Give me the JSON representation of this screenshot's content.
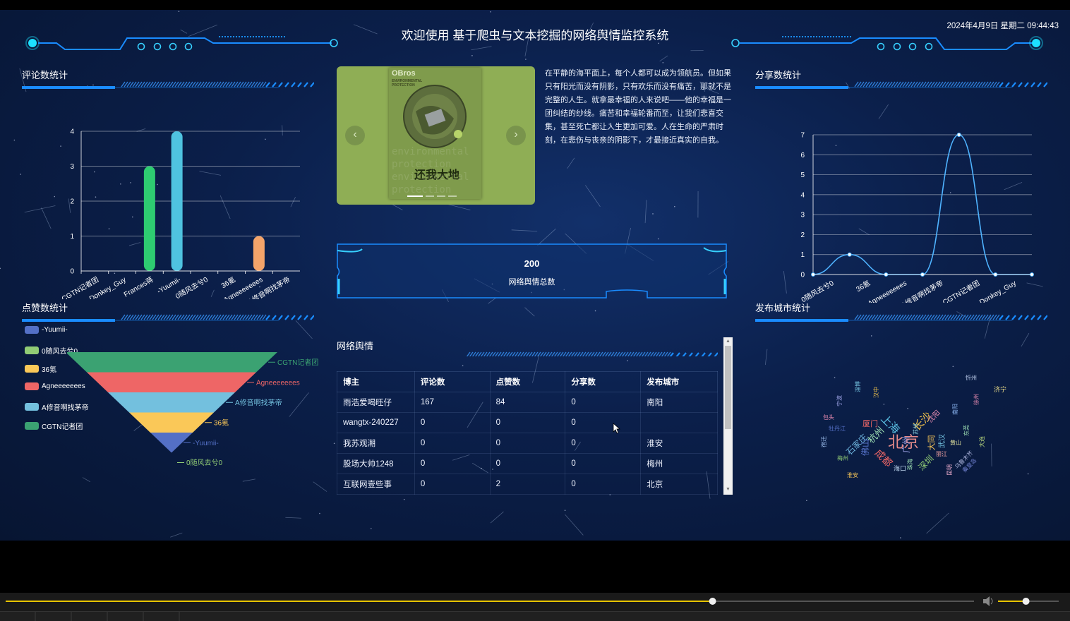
{
  "header": {
    "title": "欢迎使用 基于爬虫与文本挖掘的网络舆情监控系统",
    "datetime": "2024年4月9日 星期二 09:44:43"
  },
  "panels": {
    "comments": "评论数统计",
    "likes": "点赞数统计",
    "shares": "分享数统计",
    "cities": "发布城市统计",
    "table": "网络舆情"
  },
  "carousel": {
    "prev_icon": "chevron-left-icon",
    "next_icon": "chevron-right-icon",
    "cover_top": "OBros",
    "cover_subtitle": "ENVIRONMENTAL PROTECTION",
    "cover_title": "还我大地"
  },
  "intro": {
    "text": "在平静的海平面上，每个人都可以成为领航员。但如果只有阳光而没有阴影，只有欢乐而没有痛苦，那就不是完整的人生。就拿最幸福的人来说吧——他的幸福是一团纠结的纱线。痛苦和幸福轮番而至，让我们悲喜交集，甚至死亡都让人生更加可爱。人在生命的严肃时刻，在悲伤与丧亲的阴影下，才最接近真实的自我。"
  },
  "total": {
    "value": "200",
    "label": "网络舆情总数"
  },
  "table": {
    "headers": [
      "博主",
      "评论数",
      "点赞数",
      "分享数",
      "发布城市"
    ],
    "rows": [
      [
        "雨浩爱喝旺仔",
        "167",
        "84",
        "0",
        "南阳"
      ],
      [
        "wangtx-240227",
        "0",
        "0",
        "0",
        ""
      ],
      [
        "我苏观潮",
        "0",
        "0",
        "0",
        "淮安"
      ],
      [
        "股场大帅1248",
        "0",
        "0",
        "0",
        "梅州"
      ],
      [
        "互联网壹些事",
        "0",
        "2",
        "0",
        "北京"
      ]
    ]
  },
  "chart_data": [
    {
      "type": "bar",
      "title": "评论数统计",
      "categories": [
        "CGTN记者团",
        "Donkey_Guy",
        "Frances蒋",
        "-Yuumii-",
        "0随风去兮0",
        "36氪",
        "Agneeeeeees",
        "A修音啊找茅帝"
      ],
      "values": [
        0,
        0,
        3,
        4,
        0,
        0,
        1,
        0
      ],
      "colors": [
        "#5b9bd5",
        "#5b9bd5",
        "#2ecc71",
        "#4fc3e0",
        "#5b9bd5",
        "#5b9bd5",
        "#f4a46a",
        "#5b9bd5"
      ],
      "ylim": [
        0,
        4
      ],
      "yticks": [
        "0",
        "1",
        "2",
        "3",
        "4"
      ]
    },
    {
      "type": "funnel",
      "title": "点赞数统计",
      "legend_position": "left",
      "series": [
        {
          "name": "-Yuumii-",
          "value": 1,
          "color": "#5470c6"
        },
        {
          "name": "0随风去兮0",
          "value": 0,
          "color": "#91cc75"
        },
        {
          "name": "36氪",
          "value": 2,
          "color": "#fac858"
        },
        {
          "name": "Agneeeeeees",
          "value": 4,
          "color": "#ee6666"
        },
        {
          "name": "A修音啊找茅帝",
          "value": 3,
          "color": "#73c0de"
        },
        {
          "name": "CGTN记者团",
          "value": 5,
          "color": "#3ba272"
        }
      ]
    },
    {
      "type": "line",
      "title": "分享数统计",
      "categories": [
        "0随风去兮0",
        "36氪",
        "Agneeeeeees",
        "A修音啊找茅帝",
        "CGTN记者团",
        "Donkey_Guy"
      ],
      "x": [
        0,
        1,
        2,
        3,
        4,
        5
      ],
      "values": [
        0,
        1,
        0,
        0,
        7,
        0
      ],
      "ylim": [
        0,
        7
      ],
      "yticks": [
        "0",
        "1",
        "2",
        "3",
        "4",
        "5",
        "6",
        "7"
      ],
      "color": "#4fb3ff"
    }
  ],
  "wordcloud": [
    {
      "t": "北京",
      "c": "#e58a8a",
      "s": 22
    },
    {
      "t": "上海",
      "c": "#5cc2e6",
      "s": 15,
      "r": 45
    },
    {
      "t": "长沙",
      "c": "#f0c24a",
      "s": 15,
      "r": -45
    },
    {
      "t": "成都",
      "c": "#ee6666",
      "s": 14,
      "r": 45
    },
    {
      "t": "杭州",
      "c": "#9fe0b4",
      "s": 13,
      "r": -45
    },
    {
      "t": "石家庄",
      "c": "#6fb6e0",
      "s": 12,
      "r": -45
    },
    {
      "t": "深圳",
      "c": "#91cc75",
      "s": 12,
      "r": -45
    },
    {
      "t": "广州",
      "c": "#a0a4e8",
      "s": 12,
      "r": -90
    },
    {
      "t": "佛山",
      "c": "#5470c6",
      "s": 12,
      "r": -90
    },
    {
      "t": "大同",
      "c": "#fac858",
      "s": 11,
      "r": -90
    },
    {
      "t": "厦门",
      "c": "#ee6666",
      "s": 11
    },
    {
      "t": "武汉",
      "c": "#73c0de",
      "s": 10,
      "r": -90
    },
    {
      "t": "沈阳",
      "c": "#e58ab0",
      "s": 10,
      "r": -45
    },
    {
      "t": "海口",
      "c": "#c0d8f0",
      "s": 9
    },
    {
      "t": "济宁",
      "c": "#f0e08a",
      "s": 9
    },
    {
      "t": "忻州",
      "c": "#c0d0f0",
      "s": 8
    },
    {
      "t": "包头",
      "c": "#e58ab0",
      "s": 8
    },
    {
      "t": "丽江",
      "c": "#f0a0a0",
      "s": 8
    },
    {
      "t": "东莞",
      "c": "#9fe0b4",
      "s": 8,
      "r": -90
    },
    {
      "t": "南阳",
      "c": "#8ab4f0",
      "s": 8,
      "r": -90
    },
    {
      "t": "梅州",
      "c": "#91cc75",
      "s": 8
    },
    {
      "t": "淮安",
      "c": "#fac858",
      "s": 8
    },
    {
      "t": "汉中",
      "c": "#f0c24a",
      "s": 8,
      "r": -90
    },
    {
      "t": "淄博",
      "c": "#73c0de",
      "s": 8,
      "r": -90
    },
    {
      "t": "宁波",
      "c": "#a0a4e8",
      "s": 8,
      "r": -90
    },
    {
      "t": "徐州",
      "c": "#e58ab0",
      "s": 8,
      "r": -90
    },
    {
      "t": "乌鲁木齐",
      "c": "#b0b8e0",
      "s": 8,
      "r": -45
    },
    {
      "t": "珠海",
      "c": "#9fe0b4",
      "s": 8,
      "r": -90
    },
    {
      "t": "牡丹江",
      "c": "#5470c6",
      "s": 8
    },
    {
      "t": "黄山",
      "c": "#e6e6a0",
      "s": 8
    },
    {
      "t": "昆明",
      "c": "#f0b0d0",
      "s": 8,
      "r": -90
    },
    {
      "t": "苏州",
      "c": "#8ad0e0",
      "s": 8,
      "r": -90
    },
    {
      "t": "秦皇岛",
      "c": "#7080d0",
      "s": 8,
      "r": -45
    },
    {
      "t": "宿迁",
      "c": "#9fc0f0",
      "s": 8,
      "r": -90
    },
    {
      "t": "大连",
      "c": "#c0e080",
      "s": 8,
      "r": -90
    }
  ],
  "player": {
    "progress": 0.73,
    "volume": 0.6,
    "volume_icon": "speaker-icon"
  }
}
